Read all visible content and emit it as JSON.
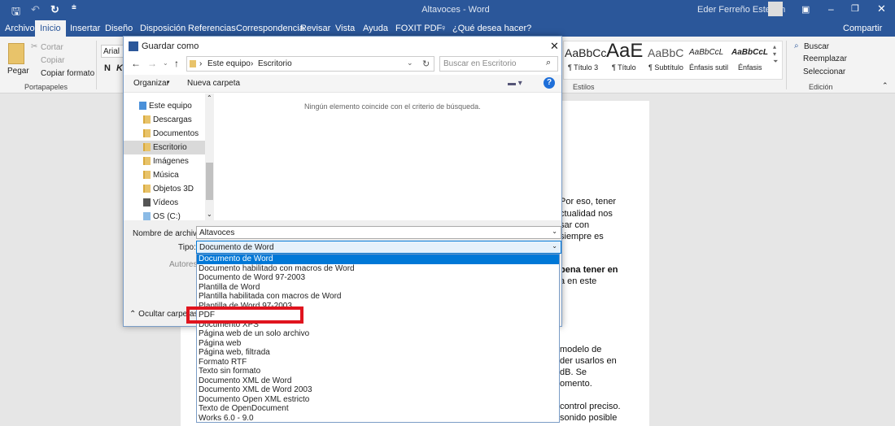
{
  "titlebar": {
    "title": "Altavoces - Word",
    "user": "Eder Ferreño Esteban"
  },
  "tabs": [
    "Archivo",
    "Inicio",
    "Insertar",
    "Diseño",
    "Disposición",
    "Referencias",
    "Correspondencia",
    "Revisar",
    "Vista",
    "Ayuda",
    "FOXIT PDF"
  ],
  "tell_me": "¿Qué desea hacer?",
  "share": "Compartir",
  "ribbon": {
    "paste": "Pegar",
    "cut": "Cortar",
    "copy": "Copiar",
    "format_painter": "Copiar formato",
    "clipboard_group": "Portapapeles",
    "font": "Arial",
    "bold": "N",
    "italic": "K",
    "styles": [
      {
        "sample": "AaBbCc",
        "name": "¶ Título 3"
      },
      {
        "sample": "AaE",
        "name": "¶ Título"
      },
      {
        "sample": "AaBbC",
        "name": "¶ Subtítulo"
      },
      {
        "sample": "AaBbCcL",
        "name": "Énfasis sutil"
      },
      {
        "sample": "AaBbCcL",
        "name": "Énfasis"
      }
    ],
    "styles_group": "Estilos",
    "find": "Buscar",
    "replace": "Reemplazar",
    "select": "Seleccionar",
    "editing_group": "Edición"
  },
  "document": {
    "lines": [
      {
        "text": "Por eso, tener",
        "bold": false
      },
      {
        "text": "ctualidad nos",
        "bold": false
      },
      {
        "text": "sar con",
        "bold": false
      },
      {
        "text": "siempre es",
        "bold": false
      },
      {
        "text": "pena tener en",
        "bold": true
      },
      {
        "text": "a en este",
        "bold": false
      },
      {
        "text": "modelo de",
        "bold": false
      },
      {
        "text": "der usarlos en",
        "bold": false
      },
      {
        "text": "dB. Se",
        "bold": false
      },
      {
        "text": "omento.",
        "bold": false
      },
      {
        "text": "control preciso.",
        "bold": false
      },
      {
        "text": "sonido posible",
        "bold": false
      }
    ]
  },
  "dialog": {
    "title": "Guardar como",
    "path": [
      "Este equipo",
      "Escritorio"
    ],
    "search_placeholder": "Buscar en Escritorio",
    "organize": "Organizar",
    "new_folder": "Nueva carpeta",
    "empty_message": "Ningún elemento coincide con el criterio de búsqueda.",
    "nav": [
      "Este equipo",
      "Descargas",
      "Documentos",
      "Escritorio",
      "Imágenes",
      "Música",
      "Objetos 3D",
      "Vídeos",
      "OS (C:)"
    ],
    "filename_label": "Nombre de archivo:",
    "filename": "Altavoces",
    "type_label": "Tipo:",
    "type_value": "Documento de Word",
    "authors_label": "Autores:",
    "hide_folders": "Ocultar carpetas"
  },
  "type_options": [
    "Documento de Word",
    "Documento habilitado con macros de Word",
    "Documento de Word 97-2003",
    "Plantilla de Word",
    "Plantilla habilitada con macros de Word",
    "Plantilla de Word 97-2003",
    "PDF",
    "Documento XPS",
    "Página web de un solo archivo",
    "Página web",
    "Página web, filtrada",
    "Formato RTF",
    "Texto sin formato",
    "Documento XML de Word",
    "Documento XML de Word 2003",
    "Documento Open XML estricto",
    "Texto de OpenDocument",
    "Works 6.0 - 9.0"
  ],
  "colors": {
    "accent": "#2b579a",
    "highlight": "#e0141e",
    "selection": "#0078d7"
  }
}
